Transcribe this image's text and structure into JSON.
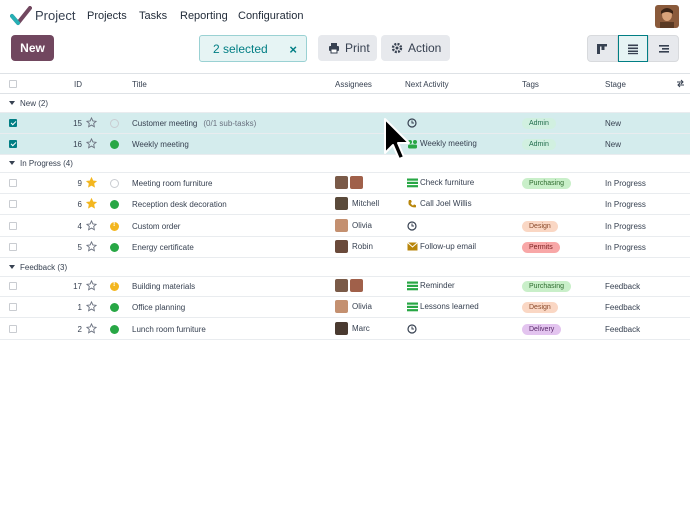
{
  "app": {
    "name": "Project"
  },
  "menu": [
    "Projects",
    "Tasks",
    "Reporting",
    "Configuration"
  ],
  "toolbar": {
    "new_label": "New",
    "selected_label": "2 selected",
    "clear_symbol": "×",
    "print_label": "Print",
    "action_label": "Action"
  },
  "columns": {
    "id": "ID",
    "title": "Title",
    "assignees": "Assignees",
    "next_activity": "Next Activity",
    "tags": "Tags",
    "stage": "Stage"
  },
  "groups": [
    {
      "label": "New (2)"
    },
    {
      "label": "In Progress (4)"
    },
    {
      "label": "Feedback (3)"
    }
  ],
  "rows": [
    {
      "id": "15",
      "title": "Customer meeting",
      "subtitle": "(0/1 sub-tasks)",
      "activity": "",
      "tag": "Admin",
      "stage": "New",
      "starred": false,
      "status": "empty",
      "selected": true,
      "assignees": [],
      "assignee_name": "",
      "activity_icon": "clock-icon"
    },
    {
      "id": "16",
      "title": "Weekly meeting",
      "subtitle": "",
      "activity": "Weekly meeting",
      "tag": "Admin",
      "stage": "New",
      "starred": false,
      "status": "green",
      "selected": true,
      "assignees": [],
      "assignee_name": "",
      "activity_icon": "team-icon"
    },
    {
      "id": "9",
      "title": "Meeting room furniture",
      "subtitle": "",
      "activity": "Check furniture",
      "tag": "Purchasing",
      "stage": "In Progress",
      "starred": true,
      "status": "empty",
      "selected": false,
      "assignees": [
        "a",
        "b"
      ],
      "assignee_name": "",
      "activity_icon": "todo-icon"
    },
    {
      "id": "6",
      "title": "Reception desk decoration",
      "subtitle": "",
      "activity": "Call Joel Willis",
      "tag": "",
      "stage": "In Progress",
      "starred": true,
      "status": "green",
      "selected": false,
      "assignees": [
        "c"
      ],
      "assignee_name": "Mitchell",
      "activity_icon": "phone-icon"
    },
    {
      "id": "4",
      "title": "Custom order",
      "subtitle": "",
      "activity": "",
      "tag": "Design",
      "stage": "In Progress",
      "starred": false,
      "status": "orange",
      "selected": false,
      "assignees": [
        "d"
      ],
      "assignee_name": "Olivia",
      "activity_icon": "clock-icon"
    },
    {
      "id": "5",
      "title": "Energy certificate",
      "subtitle": "",
      "activity": "Follow-up email",
      "tag": "Permits",
      "stage": "In Progress",
      "starred": false,
      "status": "green",
      "selected": false,
      "assignees": [
        "e"
      ],
      "assignee_name": "Robin",
      "activity_icon": "email-icon"
    },
    {
      "id": "17",
      "title": "Building materials",
      "subtitle": "",
      "activity": "Reminder",
      "tag": "Purchasing",
      "stage": "Feedback",
      "starred": false,
      "status": "orange",
      "selected": false,
      "assignees": [
        "a",
        "b"
      ],
      "assignee_name": "",
      "activity_icon": "todo-icon"
    },
    {
      "id": "1",
      "title": "Office planning",
      "subtitle": "",
      "activity": "Lessons learned",
      "tag": "Design",
      "stage": "Feedback",
      "starred": false,
      "status": "green",
      "selected": false,
      "assignees": [
        "d"
      ],
      "assignee_name": "Olivia",
      "activity_icon": "todo-icon"
    },
    {
      "id": "2",
      "title": "Lunch room furniture",
      "subtitle": "",
      "activity": "",
      "tag": "Delivery",
      "stage": "Feedback",
      "starred": false,
      "status": "green",
      "selected": false,
      "assignees": [
        "f"
      ],
      "assignee_name": "Marc",
      "activity_icon": "clock-icon"
    }
  ],
  "colors": {
    "brand": "#71475f",
    "accent": "#017e84",
    "tag_admin": "#d1f0e0",
    "tag_purchasing": "#c9efc9",
    "tag_design": "#fad7c4",
    "tag_permits": "#f8a7a7",
    "tag_delivery": "#e3c4ef"
  }
}
